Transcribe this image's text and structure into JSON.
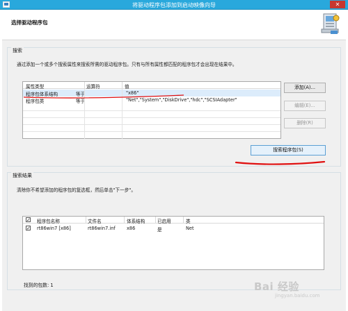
{
  "window": {
    "title": "将驱动程序包添加到启动映像向导"
  },
  "header": {
    "heading": "选择驱动程序包"
  },
  "search": {
    "group_title": "搜索",
    "description": "通过添加一个或多个搜索属性来搜索所需的驱动程序包。只有与所有属性都匹配的程序包才会出现在结果中。",
    "columns": [
      "属性类型",
      "运算符",
      "值"
    ],
    "rows": [
      [
        "程序包体系结构",
        "等于",
        "\"x86\""
      ],
      [
        "程序包类",
        "等于",
        "\"Net\",\"System\",\"DiskDrive\",\"hdc\",\"SCSIAdapter\""
      ]
    ],
    "add_label": "添加(A)...",
    "edit_label": "编辑(E)...",
    "delete_label": "删除(R)",
    "search_button_label": "搜索程序包(S)"
  },
  "results": {
    "group_title": "搜索结果",
    "description": "清除你不希望添加的程序包的复选框，然后单击\"下一步\"。",
    "columns": [
      "程序包名称",
      "文件名",
      "体系结构",
      "已启用",
      "类"
    ],
    "rows": [
      [
        "rt86win7 [x86]",
        "rt86win7.inf",
        "x86",
        "是",
        "Net"
      ]
    ],
    "header_checked": true,
    "row_checked": true,
    "found_count_label": "找到的包数: 1"
  },
  "annotation_color": "#e01010",
  "titlebar_color": "#29a8dc",
  "watermark": {
    "text": "Bai 经验",
    "url": "jingyan.baidu.com"
  }
}
